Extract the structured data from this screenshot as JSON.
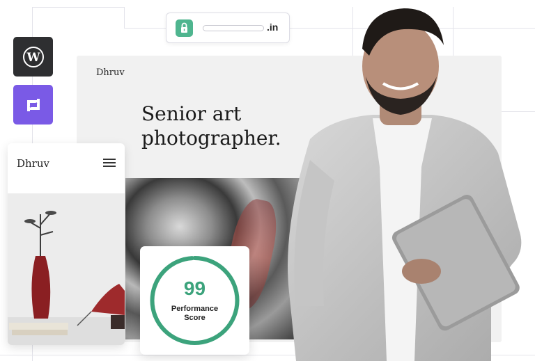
{
  "url_bar": {
    "tld": ".in"
  },
  "apps": [
    {
      "name": "WordPress",
      "icon": "wordpress-icon",
      "color": "#2e2f31"
    },
    {
      "name": "Builder",
      "icon": "site-builder-icon",
      "color": "#7a5ae6"
    }
  ],
  "desktop_site": {
    "brand": "Dhruv",
    "headline_line1": "Senior art",
    "headline_line2": "photographer."
  },
  "mobile_site": {
    "brand": "Dhruv",
    "menu_icon": "hamburger-menu-icon"
  },
  "performance": {
    "score": "99",
    "label_line1": "Performance",
    "label_line2": "Score",
    "fraction": 0.99,
    "color": "#3ca37c"
  },
  "colors": {
    "accent_green": "#4fb58f",
    "wordpress_dark": "#2e2f31",
    "purple": "#7a5ae6"
  }
}
